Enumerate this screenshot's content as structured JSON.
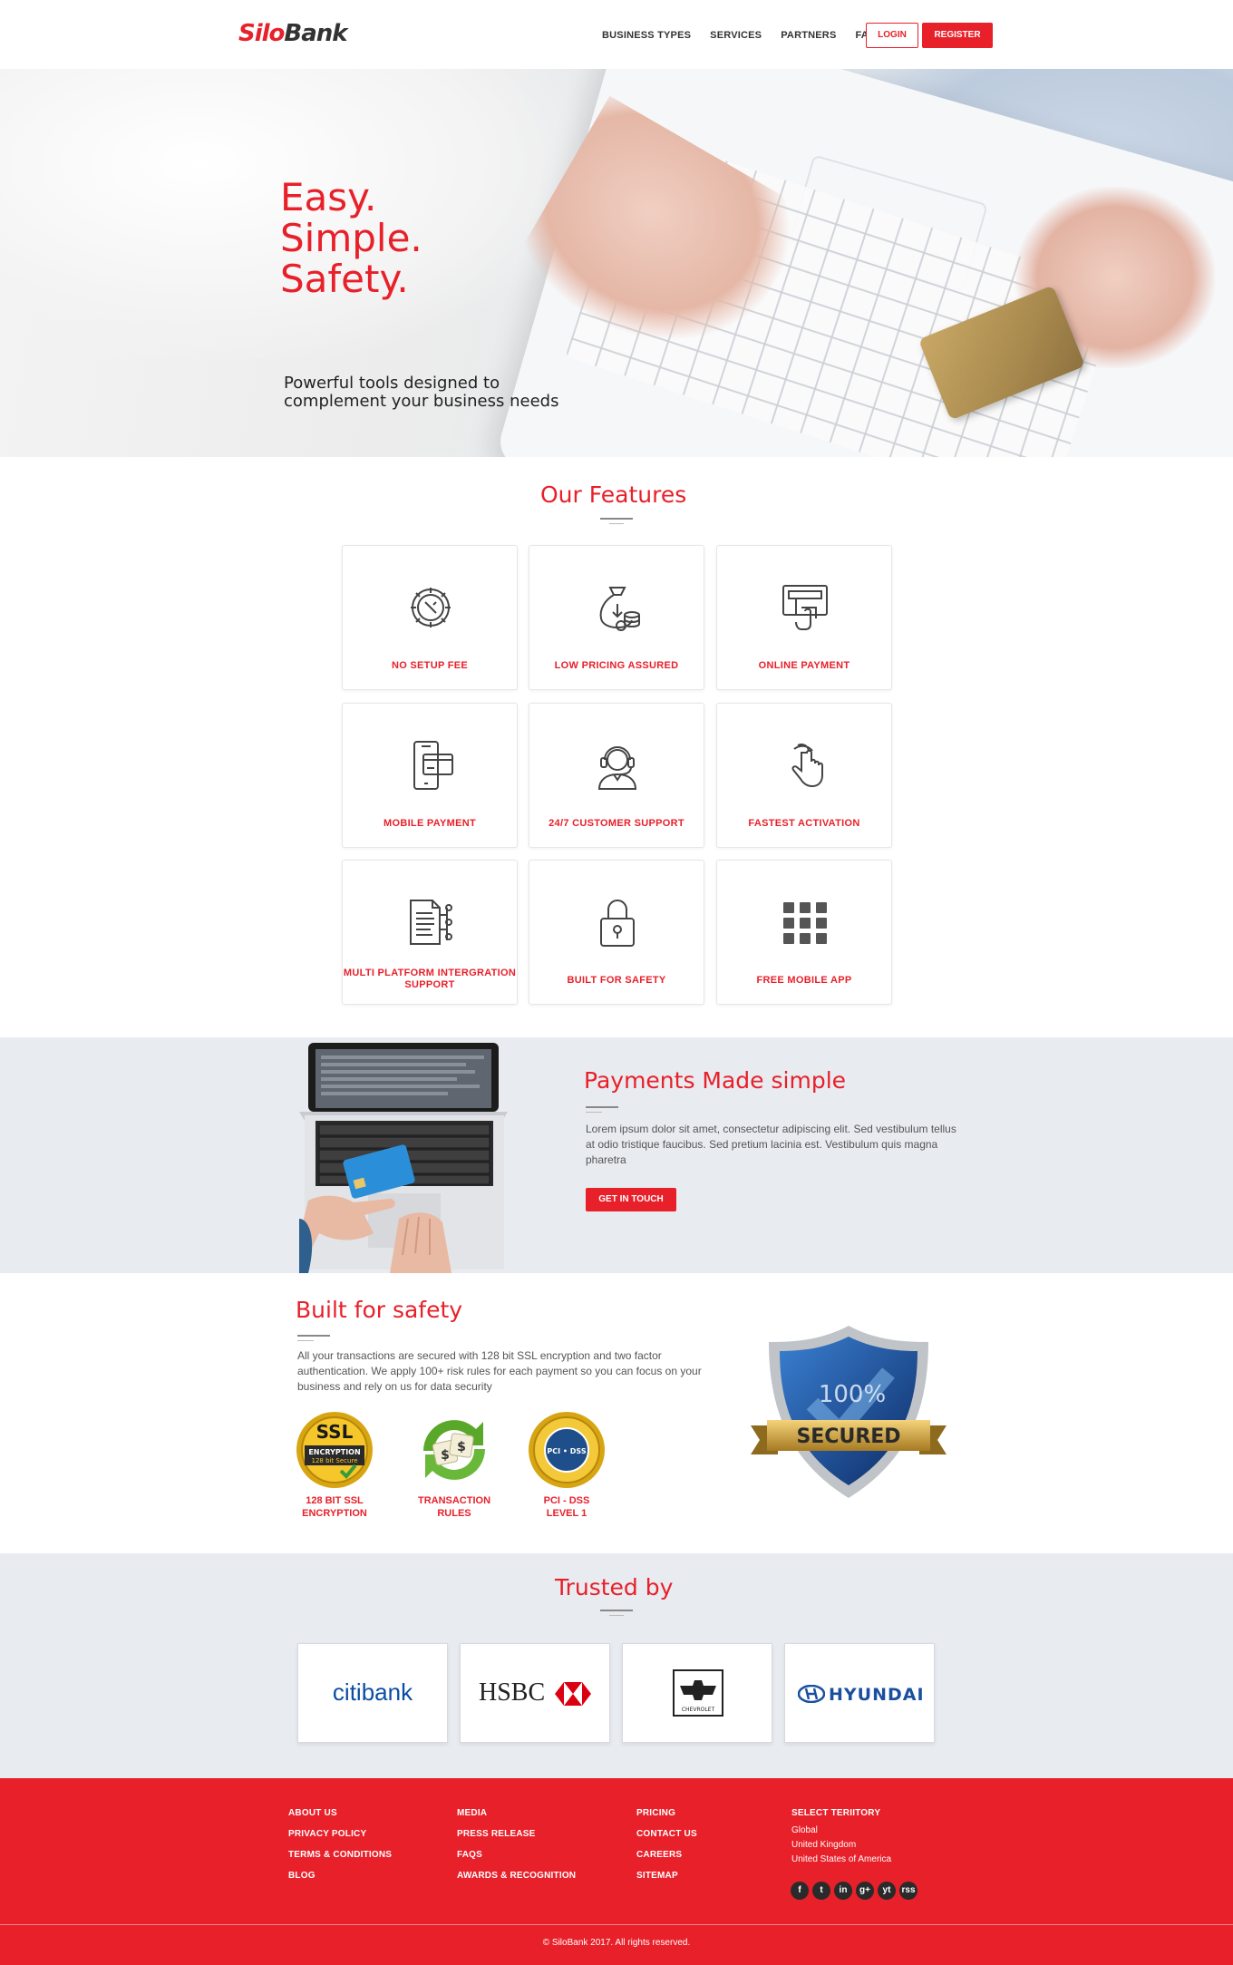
{
  "brand": {
    "name_part1": "Silo",
    "name_part2": "Bank"
  },
  "nav": {
    "links": [
      "BUSINESS TYPES",
      "SERVICES",
      "PARTNERS",
      "FAQ"
    ],
    "login": "LOGIN",
    "register": "REGISTER"
  },
  "hero": {
    "lines": [
      "Easy.",
      "Simple.",
      "Safety."
    ],
    "subtitle": "Powerful tools designed to complement your business needs"
  },
  "features": {
    "title": "Our Features",
    "items": [
      {
        "label": "NO SETUP FEE",
        "icon": "gear-wrench-icon"
      },
      {
        "label": "LOW PRICING ASSURED",
        "icon": "money-bag-icon"
      },
      {
        "label": "ONLINE PAYMENT",
        "icon": "atm-icon"
      },
      {
        "label": "MOBILE PAYMENT",
        "icon": "mobile-card-icon"
      },
      {
        "label": "24/7 CUSTOMER SUPPORT",
        "icon": "headset-icon"
      },
      {
        "label": "FASTEST ACTIVATION",
        "icon": "pointer-hand-icon"
      },
      {
        "label": "MULTI PLATFORM INTERGRATION SUPPORT",
        "icon": "document-network-icon"
      },
      {
        "label": "BUILT FOR SAFETY",
        "icon": "padlock-icon"
      },
      {
        "label": "FREE MOBILE APP",
        "icon": "app-grid-icon"
      }
    ]
  },
  "payments": {
    "title": "Payments Made simple",
    "body": "Lorem ipsum dolor sit amet, consectetur adipiscing elit. Sed vestibulum tellus at odio tristique faucibus. Sed pretium lacinia est. Vestibulum quis magna pharetra",
    "button": "GET IN TOUCH"
  },
  "safety": {
    "title": "Built for safety",
    "body": "All your transactions are secured with 128 bit SSL encryption and two factor authentication. We apply 100+ risk rules for each payment so you can focus on your business and rely on us for data security",
    "badges": [
      {
        "line1": "128 BIT SSL",
        "line2": "ENCRYPTION",
        "seal_top": "SSL",
        "seal_mid": "ENCRYPTION",
        "seal_bot": "128 bit Secure"
      },
      {
        "line1": "TRANSACTION",
        "line2": "RULES"
      },
      {
        "line1": "PCI - DSS",
        "line2": "LEVEL 1",
        "seal_text": "PCI • DSS"
      }
    ],
    "shield_pct": "100%",
    "shield_label": "SECURED"
  },
  "trusted": {
    "title": "Trusted by",
    "partners": [
      "citibank",
      "HSBC",
      "CHEVROLET",
      "HYUNDAI"
    ]
  },
  "footer": {
    "col1": [
      "ABOUT US",
      "PRIVACY POLICY",
      "TERMS & CONDITIONS",
      "BLOG"
    ],
    "col2": [
      "MEDIA",
      "PRESS RELEASE",
      "FAQS",
      "AWARDS & RECOGNITION"
    ],
    "col3": [
      "PRICING",
      "CONTACT US",
      "CAREERS",
      "SITEMAP"
    ],
    "territory_title": "SELECT TERIITORY",
    "territories": [
      "Global",
      "United Kingdom",
      "United States of America"
    ],
    "social": [
      "f",
      "t",
      "in",
      "g+",
      "yt",
      "rss"
    ],
    "copyright": "© SiloBank 2017. All rights reserved."
  },
  "colors": {
    "accent": "#e8202a",
    "panel": "#e8ebf0",
    "dark": "#333333"
  }
}
